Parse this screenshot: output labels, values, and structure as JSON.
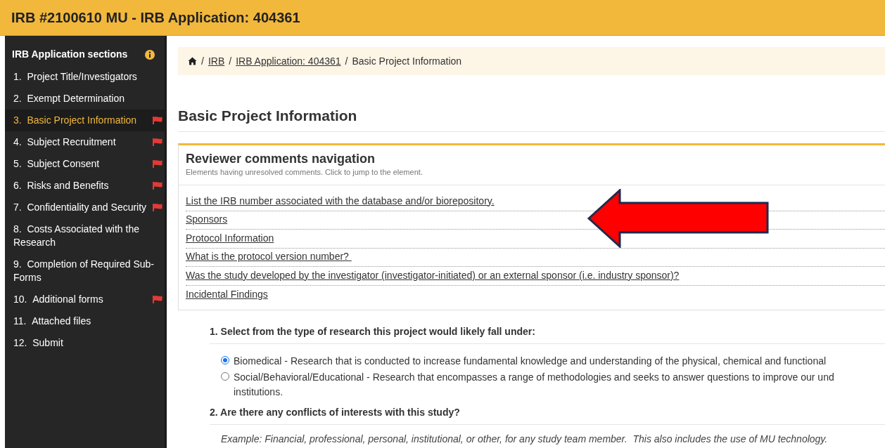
{
  "header": {
    "title": "IRB #2100610 MU - IRB Application: 404361"
  },
  "sidebar": {
    "title": "IRB Application sections",
    "items": [
      {
        "number": "1.",
        "label": "Project Title/Investigators",
        "selected": false,
        "flagged": false
      },
      {
        "number": "2.",
        "label": "Exempt Determination",
        "selected": false,
        "flagged": false
      },
      {
        "number": "3.",
        "label": "Basic Project Information",
        "selected": true,
        "flagged": true
      },
      {
        "number": "4.",
        "label": "Subject Recruitment",
        "selected": false,
        "flagged": true
      },
      {
        "number": "5.",
        "label": "Subject Consent",
        "selected": false,
        "flagged": true
      },
      {
        "number": "6.",
        "label": "Risks and Benefits",
        "selected": false,
        "flagged": true
      },
      {
        "number": "7.",
        "label": "Confidentiality and Security",
        "selected": false,
        "flagged": true
      },
      {
        "number": "8.",
        "label": "Costs Associated with the Research",
        "selected": false,
        "flagged": false
      },
      {
        "number": "9.",
        "label": "Completion of Required Sub-Forms",
        "selected": false,
        "flagged": false
      },
      {
        "number": "10.",
        "label": "Additional forms",
        "selected": false,
        "flagged": true
      },
      {
        "number": "11.",
        "label": "Attached files",
        "selected": false,
        "flagged": false
      },
      {
        "number": "12.",
        "label": "Submit",
        "selected": false,
        "flagged": false
      }
    ]
  },
  "breadcrumb": [
    {
      "label": "/",
      "kind": "separator"
    },
    {
      "label": "IRB",
      "kind": "link"
    },
    {
      "label": "/",
      "kind": "separator"
    },
    {
      "label": "IRB Application: 404361",
      "kind": "link"
    },
    {
      "label": "/",
      "kind": "separator"
    },
    {
      "label": "Basic Project Information",
      "kind": "current"
    }
  ],
  "page_title": "Basic Project Information",
  "reviewer_comments": {
    "title": "Reviewer comments navigation",
    "subtitle": "Elements having unresolved comments. Click to jump to the element.",
    "links": [
      "List the IRB number associated with the database and/or biorepository.",
      "Sponsors",
      "Protocol Information",
      "What is the protocol version number? ",
      "Was the study developed by the investigator (investigator-initiated) or an external sponsor (i.e. industry sponsor)?",
      "Incidental Findings"
    ]
  },
  "questions": [
    {
      "text": "1. Select from the type of research this project would likely fall under:",
      "options": [
        {
          "label": "Biomedical - Research that is conducted to increase fundamental knowledge and understanding of the physical, chemical and functional",
          "selected": true
        },
        {
          "label": "Social/Behavioral/Educational - Research that encompasses a range of methodologies and seeks to answer questions to improve our und",
          "continuation": "institutions.",
          "selected": false
        }
      ]
    },
    {
      "text": "2. Are there any conflicts of interests with this study?",
      "hint": "Example: Financial, professional, personal, institutional, or other, for any study team member.  This also includes the use of MU technology."
    }
  ]
}
